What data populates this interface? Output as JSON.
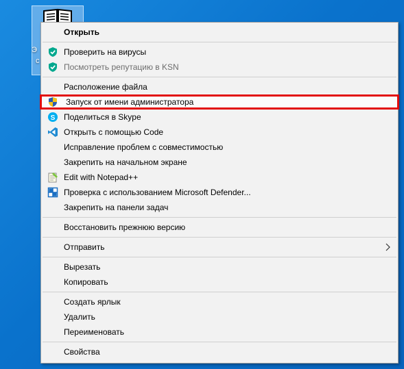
{
  "desktop": {
    "icon_label_line1": "Э",
    "icon_label_line2": "с"
  },
  "menu": {
    "items": [
      {
        "label": "Открыть"
      },
      {
        "label": "Проверить на вирусы",
        "icon": "kaspersky-shield-icon"
      },
      {
        "label": "Посмотреть репутацию в KSN",
        "icon": "kaspersky-shield-icon"
      },
      {
        "label": "Расположение файла"
      },
      {
        "label": "Запуск от имени администратора",
        "icon": "uac-shield-icon"
      },
      {
        "label": "Поделиться в Skype",
        "icon": "skype-icon"
      },
      {
        "label": "Открыть с помощью Code",
        "icon": "vscode-icon"
      },
      {
        "label": "Исправление проблем с совместимостью"
      },
      {
        "label": "Закрепить на начальном экране"
      },
      {
        "label": "Edit with Notepad++",
        "icon": "notepadpp-icon"
      },
      {
        "label": "Проверка с использованием Microsoft Defender...",
        "icon": "defender-icon"
      },
      {
        "label": "Закрепить на панели задач"
      },
      {
        "label": "Восстановить прежнюю версию"
      },
      {
        "label": "Отправить",
        "icon": "chevron-right-icon"
      },
      {
        "label": "Вырезать"
      },
      {
        "label": "Копировать"
      },
      {
        "label": "Создать ярлык"
      },
      {
        "label": "Удалить"
      },
      {
        "label": "Переименовать"
      },
      {
        "label": "Свойства"
      }
    ]
  },
  "colors": {
    "desktop_bg": "#0b78d4",
    "highlight_border": "#e20d0d",
    "menu_bg": "#f2f2f2"
  }
}
